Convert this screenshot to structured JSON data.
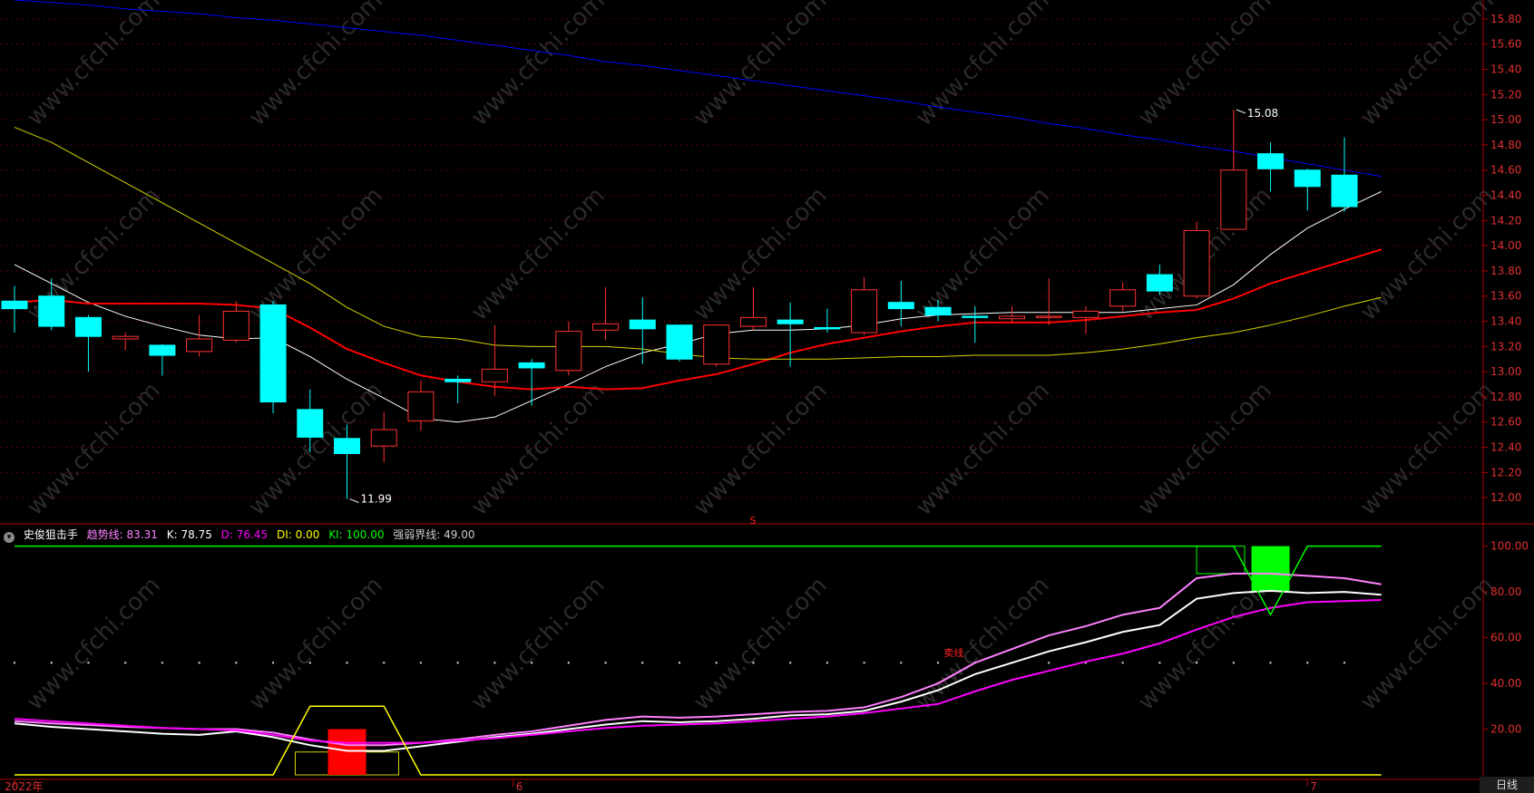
{
  "colors": {
    "background": "#000000",
    "axis": "#b00000",
    "up_candle": "#ff3232",
    "down_candle": "#00ffff",
    "ma_white": "#ffffff",
    "ma_red": "#ff0000",
    "ma_yellow": "#d4d400",
    "ma_blue": "#0000ff",
    "indicator_k": "#ffffff",
    "indicator_trend": "#ff80ff",
    "indicator_d": "#ff00ff",
    "indicator_ki": "#00ff00",
    "indicator_di": "#ffff00"
  },
  "watermark": "www.cfchi.com",
  "indicator_panel": {
    "name": "史俊狙击手",
    "values": [
      {
        "label": "趋势线:",
        "value": "83.31",
        "color": "#ff80ff"
      },
      {
        "label": "K:",
        "value": "78.75",
        "color": "#ffffff"
      },
      {
        "label": "D:",
        "value": "76.45",
        "color": "#ff00ff"
      },
      {
        "label": "DI:",
        "value": "0.00",
        "color": "#ffff00"
      },
      {
        "label": "KI:",
        "value": "100.00",
        "color": "#00ff00"
      },
      {
        "label": "强弱界线:",
        "value": "49.00",
        "color": "#cccccc"
      }
    ],
    "marker_text": "卖线"
  },
  "period_label": "日线",
  "chart_data": [
    {
      "type": "candlestick",
      "ylim": [
        11.85,
        15.95
      ],
      "y_ticks": [
        "12.00",
        "12.20",
        "12.40",
        "12.60",
        "12.80",
        "13.00",
        "13.20",
        "13.40",
        "13.60",
        "13.80",
        "14.00",
        "14.20",
        "14.40",
        "14.60",
        "14.80",
        "15.00",
        "15.20",
        "15.40",
        "15.60",
        "15.80"
      ],
      "x_ticks": [
        "2022年",
        "6",
        "7"
      ],
      "x_tick_index": [
        0,
        13.5,
        35
      ],
      "candles": [
        {
          "o": 13.56,
          "h": 13.68,
          "l": 13.31,
          "c": 13.5
        },
        {
          "o": 13.6,
          "h": 13.74,
          "l": 13.33,
          "c": 13.36
        },
        {
          "o": 13.43,
          "h": 13.45,
          "l": 13.0,
          "c": 13.28
        },
        {
          "o": 13.26,
          "h": 13.31,
          "l": 13.17,
          "c": 13.28
        },
        {
          "o": 13.21,
          "h": 13.22,
          "l": 12.97,
          "c": 13.13
        },
        {
          "o": 13.16,
          "h": 13.45,
          "l": 13.12,
          "c": 13.26
        },
        {
          "o": 13.25,
          "h": 13.56,
          "l": 13.23,
          "c": 13.48
        },
        {
          "o": 13.53,
          "h": 13.56,
          "l": 12.67,
          "c": 12.76
        },
        {
          "o": 12.7,
          "h": 12.86,
          "l": 12.36,
          "c": 12.48
        },
        {
          "o": 12.47,
          "h": 12.58,
          "l": 11.99,
          "c": 12.35
        },
        {
          "o": 12.41,
          "h": 12.68,
          "l": 12.28,
          "c": 12.54
        },
        {
          "o": 12.61,
          "h": 12.93,
          "l": 12.53,
          "c": 12.84
        },
        {
          "o": 12.94,
          "h": 12.97,
          "l": 12.75,
          "c": 12.92
        },
        {
          "o": 12.92,
          "h": 13.37,
          "l": 12.81,
          "c": 13.02
        },
        {
          "o": 13.07,
          "h": 13.1,
          "l": 12.73,
          "c": 13.03
        },
        {
          "o": 13.01,
          "h": 13.4,
          "l": 12.97,
          "c": 13.32
        },
        {
          "o": 13.33,
          "h": 13.67,
          "l": 13.25,
          "c": 13.38
        },
        {
          "o": 13.41,
          "h": 13.59,
          "l": 13.06,
          "c": 13.34
        },
        {
          "o": 13.37,
          "h": 13.37,
          "l": 13.08,
          "c": 13.1
        },
        {
          "o": 13.06,
          "h": 13.37,
          "l": 13.04,
          "c": 13.37
        },
        {
          "o": 13.36,
          "h": 13.67,
          "l": 13.33,
          "c": 13.43
        },
        {
          "o": 13.41,
          "h": 13.55,
          "l": 13.04,
          "c": 13.38
        },
        {
          "o": 13.35,
          "h": 13.5,
          "l": 13.31,
          "c": 13.34
        },
        {
          "o": 13.31,
          "h": 13.75,
          "l": 13.29,
          "c": 13.65
        },
        {
          "o": 13.55,
          "h": 13.72,
          "l": 13.36,
          "c": 13.5
        },
        {
          "o": 13.51,
          "h": 13.57,
          "l": 13.4,
          "c": 13.45
        },
        {
          "o": 13.44,
          "h": 13.52,
          "l": 13.23,
          "c": 13.43
        },
        {
          "o": 13.42,
          "h": 13.52,
          "l": 13.39,
          "c": 13.44
        },
        {
          "o": 13.43,
          "h": 13.74,
          "l": 13.37,
          "c": 13.44
        },
        {
          "o": 13.43,
          "h": 13.52,
          "l": 13.3,
          "c": 13.48
        },
        {
          "o": 13.52,
          "h": 13.71,
          "l": 13.48,
          "c": 13.65
        },
        {
          "o": 13.77,
          "h": 13.85,
          "l": 13.61,
          "c": 13.64
        },
        {
          "o": 13.6,
          "h": 14.19,
          "l": 13.58,
          "c": 14.12
        },
        {
          "o": 14.13,
          "h": 15.08,
          "l": 14.13,
          "c": 14.6
        },
        {
          "o": 14.73,
          "h": 14.82,
          "l": 14.43,
          "c": 14.61
        },
        {
          "o": 14.6,
          "h": 14.61,
          "l": 14.28,
          "c": 14.47
        },
        {
          "o": 14.56,
          "h": 14.86,
          "l": 14.27,
          "c": 14.31
        }
      ],
      "annotations": [
        {
          "text": "15.08",
          "index": 33,
          "value": 15.08
        },
        {
          "text": "11.99",
          "index": 9,
          "value": 11.99
        }
      ],
      "series": [
        {
          "color": "#ffffff",
          "values": [
            13.85,
            13.7,
            13.55,
            13.44,
            13.36,
            13.29,
            13.26,
            13.27,
            13.12,
            12.94,
            12.79,
            12.63,
            12.6,
            12.64,
            12.77,
            12.9,
            13.04,
            13.15,
            13.22,
            13.3,
            13.33,
            13.33,
            13.34,
            13.37,
            13.42,
            13.45,
            13.46,
            13.47,
            13.47,
            13.47,
            13.47,
            13.5,
            13.53,
            13.69,
            13.93,
            14.14,
            14.29,
            14.43
          ]
        },
        {
          "color": "#ff0000",
          "values": [
            13.55,
            13.57,
            13.54,
            13.54,
            13.54,
            13.54,
            13.53,
            13.5,
            13.35,
            13.18,
            13.07,
            12.97,
            12.92,
            12.88,
            12.86,
            12.88,
            12.86,
            12.87,
            12.93,
            12.98,
            13.06,
            13.15,
            13.22,
            13.27,
            13.32,
            13.36,
            13.39,
            13.39,
            13.39,
            13.41,
            13.44,
            13.47,
            13.49,
            13.58,
            13.7,
            13.79,
            13.88,
            13.97
          ]
        },
        {
          "color": "#d4d400",
          "values": [
            14.94,
            14.82,
            14.66,
            14.5,
            14.34,
            14.18,
            14.02,
            13.86,
            13.7,
            13.51,
            13.36,
            13.28,
            13.26,
            13.21,
            13.2,
            13.2,
            13.2,
            13.18,
            13.14,
            13.11,
            13.1,
            13.1,
            13.1,
            13.11,
            13.12,
            13.12,
            13.13,
            13.13,
            13.13,
            13.15,
            13.18,
            13.22,
            13.27,
            13.31,
            13.37,
            13.44,
            13.52,
            13.59
          ]
        },
        {
          "color": "#0000ff",
          "values": [
            15.95,
            15.93,
            15.91,
            15.88,
            15.86,
            15.84,
            15.81,
            15.79,
            15.76,
            15.73,
            15.7,
            15.67,
            15.63,
            15.59,
            15.55,
            15.51,
            15.46,
            15.43,
            15.39,
            15.35,
            15.31,
            15.27,
            15.23,
            15.19,
            15.15,
            15.1,
            15.06,
            15.02,
            14.97,
            14.93,
            14.88,
            14.84,
            14.79,
            14.75,
            14.7,
            14.65,
            14.6,
            14.55
          ]
        }
      ],
      "markers": [
        {
          "text": "S",
          "index": 20
        }
      ]
    },
    {
      "type": "line",
      "ylim": [
        0,
        105
      ],
      "y_ticks": [
        "20.00",
        "40.00",
        "60.00",
        "80.00",
        "100.00"
      ],
      "series": [
        {
          "name": "趋势线",
          "color": "#ff80ff",
          "values": [
            23.5,
            22.5,
            21.8,
            21.0,
            20.5,
            20.0,
            20.0,
            18.5,
            15.5,
            13.0,
            13.0,
            14.0,
            15.5,
            17.5,
            19.0,
            21.5,
            24.0,
            25.5,
            25.0,
            25.5,
            26.5,
            27.5,
            28.0,
            29.5,
            34.0,
            40.0,
            49.0,
            55.0,
            61.0,
            65.0,
            70.0,
            73.0,
            86.0,
            88.0,
            88.0,
            87.0,
            86.0,
            83.31
          ]
        },
        {
          "name": "K",
          "color": "#ffffff",
          "values": [
            22.5,
            21.0,
            20.0,
            19.0,
            18.0,
            17.5,
            19.0,
            16.5,
            13.0,
            10.5,
            10.5,
            12.5,
            14.5,
            16.5,
            18.0,
            20.0,
            22.0,
            23.5,
            23.0,
            23.5,
            24.5,
            26.0,
            26.5,
            28.0,
            32.0,
            37.0,
            44.0,
            49.0,
            54.0,
            58.0,
            62.5,
            65.5,
            77.0,
            79.5,
            80.5,
            79.5,
            80.0,
            78.75
          ]
        },
        {
          "name": "D",
          "color": "#ff00ff",
          "values": [
            24.5,
            23.5,
            22.5,
            21.5,
            20.5,
            20.0,
            19.5,
            17.5,
            15.0,
            14.0,
            14.0,
            14.0,
            15.0,
            16.0,
            17.5,
            19.0,
            20.5,
            21.5,
            22.0,
            22.5,
            23.5,
            24.5,
            25.5,
            27.0,
            29.0,
            31.0,
            36.5,
            41.5,
            45.5,
            49.5,
            53.0,
            57.5,
            63.5,
            69.0,
            73.0,
            75.5,
            76.0,
            76.45
          ]
        },
        {
          "name": "DI",
          "color": "#ffff00",
          "values": [
            0,
            0,
            0,
            0,
            0,
            0,
            0,
            0,
            30,
            30,
            30,
            0,
            0,
            0,
            0,
            0,
            0,
            0,
            0,
            0,
            0,
            0,
            0,
            0,
            0,
            0,
            0,
            0,
            0,
            0,
            0,
            0,
            0,
            0,
            0,
            0,
            0,
            0
          ]
        },
        {
          "name": "KI",
          "color": "#00ff00",
          "values": [
            100,
            100,
            100,
            100,
            100,
            100,
            100,
            100,
            100,
            100,
            100,
            100,
            100,
            100,
            100,
            100,
            100,
            100,
            100,
            100,
            100,
            100,
            100,
            100,
            100,
            100,
            100,
            100,
            100,
            100,
            100,
            100,
            100,
            100,
            70,
            100,
            100,
            100
          ]
        },
        {
          "name": "强弱界线",
          "color": "#cccccc",
          "values": [
            49,
            49,
            49,
            49,
            49,
            49,
            49,
            49,
            49,
            49,
            49,
            49,
            49,
            49,
            49,
            49,
            49,
            49,
            49,
            49,
            49,
            49,
            49,
            49,
            49,
            49,
            49,
            49,
            49,
            49,
            49,
            49,
            49,
            49,
            49,
            49,
            49,
            49
          ]
        }
      ],
      "bars": [
        {
          "index": 9,
          "from": 0,
          "to": 20,
          "color": "#ff0000"
        },
        {
          "index": 34,
          "from": 80,
          "to": 100,
          "color": "#00ff00"
        }
      ],
      "outline_boxes": [
        {
          "from_index": 7.6,
          "to_index": 10.4,
          "from": 0,
          "to": 10,
          "color": "#d4d400"
        },
        {
          "from_index": 32.0,
          "to_index": 33.3,
          "from": 88,
          "to": 100,
          "color": "#00ff00"
        }
      ],
      "marker_index": 25.5
    }
  ]
}
